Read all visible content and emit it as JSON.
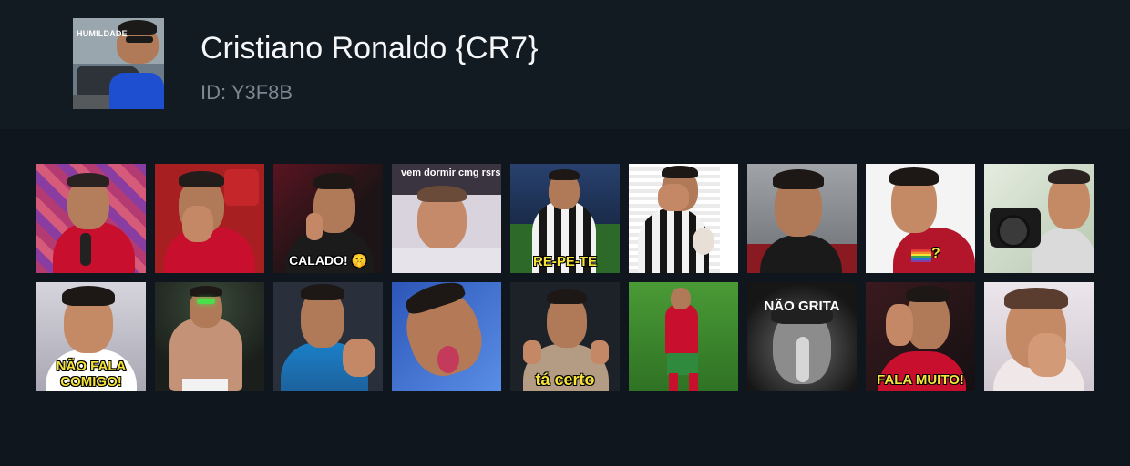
{
  "pack": {
    "avatar_caption": "HUMILDADE",
    "title": "Cristiano Ronaldo {CR7}",
    "id_text": "ID: Y3F8B"
  },
  "stickers": [
    {
      "name": "sticker-interview-united",
      "caption": "",
      "bg": "#c03a6a",
      "shirt": "#c8102e"
    },
    {
      "name": "sticker-facepalm-united",
      "caption": "",
      "bg": "#a81f22",
      "shirt": "#c8102e"
    },
    {
      "name": "sticker-calado",
      "caption": "CALADO! 🤫",
      "bg": "#2a1a1c",
      "shirt": "#1b1b1b"
    },
    {
      "name": "sticker-vem-dormir",
      "caption": "vem dormir cmg rsrs",
      "bg": "#d9d3dd",
      "shirt": "#e7e3ea"
    },
    {
      "name": "sticker-re-pe-te",
      "caption": "RE-PE-TE",
      "bg": "#2a4a7a",
      "shirt": "#f2f2f2"
    },
    {
      "name": "sticker-hands-face-juventus",
      "caption": "",
      "bg": "#ffffff",
      "shirt": "#f2f2f2"
    },
    {
      "name": "sticker-bench-frown",
      "caption": "",
      "bg": "#8d9298",
      "shirt": "#1a1a1a"
    },
    {
      "name": "sticker-question",
      "caption": "?",
      "bg": "#f4f4f4",
      "shirt": "#b3152a"
    },
    {
      "name": "sticker-camera",
      "caption": "",
      "bg": "#d7e2d3",
      "shirt": "#dadada"
    },
    {
      "name": "sticker-nao-fala-comigo",
      "caption": "NÃO FALA COMIGO!",
      "bg": "#c8c6cf",
      "shirt": "#ffffff"
    },
    {
      "name": "sticker-shirtless-stadium",
      "caption": "",
      "bg": "#2b2f2a",
      "shirt": "#c49377"
    },
    {
      "name": "sticker-clap-juventus-blue",
      "caption": "",
      "bg": "#2a2f3c",
      "shirt": "#1a80c8"
    },
    {
      "name": "sticker-tongue-out",
      "caption": "",
      "bg": "#2c56b8",
      "shirt": "#2a6fd6"
    },
    {
      "name": "sticker-ta-certo",
      "caption": "tá certo",
      "bg": "#1d2229",
      "shirt": "#b49b84"
    },
    {
      "name": "sticker-portugal-celebration",
      "caption": "",
      "bg": "#3f8a2e",
      "shirt": "#c8102e"
    },
    {
      "name": "sticker-nao-grita",
      "caption": "NÃO GRITA",
      "bg": "#181818",
      "shirt": "#2a2a2a"
    },
    {
      "name": "sticker-fala-muito",
      "caption": "FALA MUITO!",
      "bg": "#1e1416",
      "shirt": "#c8102e"
    },
    {
      "name": "sticker-hand-nose",
      "caption": "",
      "bg": "#e3dde3",
      "shirt": "#f0e7e9"
    }
  ]
}
